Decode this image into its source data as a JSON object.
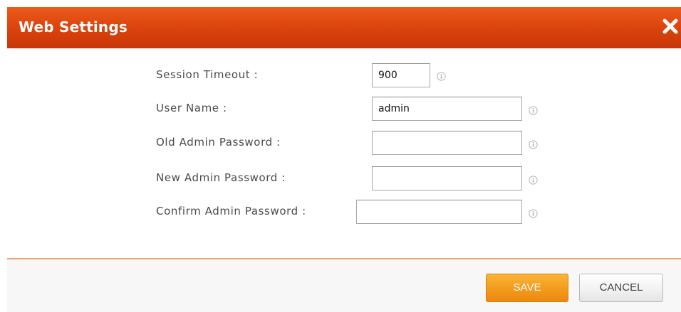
{
  "dialog": {
    "title": "Web Settings",
    "close_icon": "close-icon"
  },
  "form": {
    "fields": [
      {
        "label": "Session Timeout :",
        "value": "900",
        "info_icon": "info-icon"
      },
      {
        "label": "User Name :",
        "value": "admin",
        "info_icon": "info-icon"
      },
      {
        "label": "Old Admin Password :",
        "value": "",
        "info_icon": "info-icon"
      },
      {
        "label": "New Admin Password :",
        "value": "",
        "info_icon": "info-icon"
      },
      {
        "label": "Confirm Admin Password :",
        "value": "",
        "info_icon": "info-icon"
      }
    ]
  },
  "footer": {
    "save_label": "SAVE",
    "cancel_label": "CANCEL"
  },
  "colors": {
    "titlebar": "#d9420c",
    "save_button": "#f39a1c",
    "divider": "#f1a073"
  }
}
